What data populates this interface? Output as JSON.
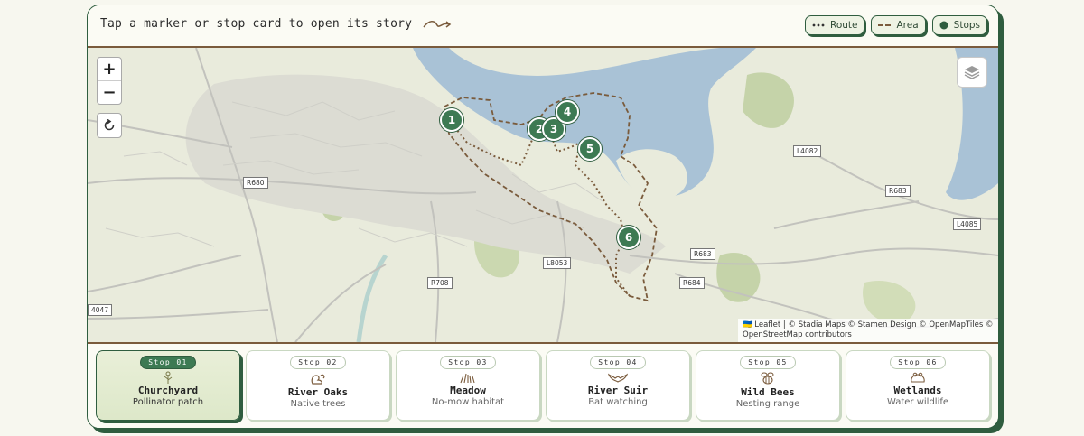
{
  "header": {
    "hint": "Tap a marker or stop card to open its story",
    "legend": [
      {
        "label": "Route",
        "icon": "dots-icon"
      },
      {
        "label": "Area",
        "icon": "dash-icon"
      },
      {
        "label": "Stops",
        "icon": "dot-icon"
      }
    ]
  },
  "map": {
    "zoom_in": "+",
    "zoom_out": "−",
    "markers": [
      "1",
      "2",
      "3",
      "4",
      "5",
      "6"
    ],
    "road_labels": [
      "R680",
      "L4082",
      "R683",
      "L4085",
      "R683",
      "R684",
      "L8053",
      "R708",
      "4047"
    ],
    "attribution": "🇺🇦 Leaflet | © Stadia Maps © Stamen Design © OpenMapTiles © OpenStreetMap contributors",
    "colors": {
      "water": "#9fb9cf",
      "land": "#e9ebdc",
      "route": "#7a5b3c",
      "marker": "#3d7a53"
    }
  },
  "stops": [
    {
      "badge": "Stop 01",
      "title": "Churchyard",
      "subtitle": "Pollinator patch",
      "icon": "flower-icon"
    },
    {
      "badge": "Stop 02",
      "title": "River Oaks",
      "subtitle": "Native trees",
      "icon": "squirrel-icon"
    },
    {
      "badge": "Stop 03",
      "title": "Meadow",
      "subtitle": "No-mow habitat",
      "icon": "grass-icon"
    },
    {
      "badge": "Stop 04",
      "title": "River Suir",
      "subtitle": "Bat watching",
      "icon": "bat-icon"
    },
    {
      "badge": "Stop 05",
      "title": "Wild Bees",
      "subtitle": "Nesting range",
      "icon": "bee-icon"
    },
    {
      "badge": "Stop 06",
      "title": "Wetlands",
      "subtitle": "Water wildlife",
      "icon": "frog-icon"
    }
  ]
}
